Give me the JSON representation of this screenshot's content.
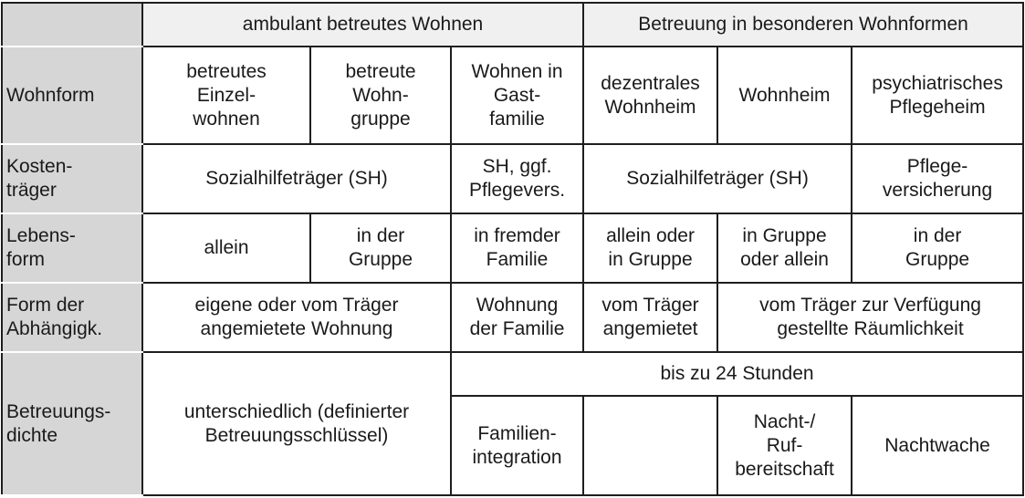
{
  "table": {
    "group_headers": {
      "ambulant": "ambulant betreutes Wohnen",
      "besondere": "Betreuung in besonderen Wohnformen"
    },
    "row_labels": {
      "wohnform": "Wohnform",
      "kostentraeger": "Kosten-\nträger",
      "lebensform": "Lebens-\nform",
      "abhaengigkeit": "Form der\nAbhängigk.",
      "betreuungsdichte": "Betreuungs-\ndichte"
    },
    "wohnform": {
      "c1": "betreutes\nEinzel-\nwohnen",
      "c2": "betreute\nWohn-\ngruppe",
      "c3": "Wohnen in\nGast-\nfamilie",
      "c4": "dezentrales\nWohnheim",
      "c5": "Wohnheim",
      "c6": "psychiatrisches\nPflegeheim"
    },
    "kostentraeger": {
      "c1_2": "Sozialhilfeträger (SH)",
      "c3": "SH, ggf.\nPflegevers.",
      "c4_5": "Sozialhilfeträger (SH)",
      "c6": "Pflege-\nversicherung"
    },
    "lebensform": {
      "c1": "allein",
      "c2": "in der\nGruppe",
      "c3": "in fremder\nFamilie",
      "c4": "allein oder\nin Gruppe",
      "c5": "in Gruppe\noder allein",
      "c6": "in der\nGruppe"
    },
    "abhaengigkeit": {
      "c1_2": "eigene oder vom Träger\nangemietete Wohnung",
      "c3": "Wohnung\nder Familie",
      "c4": "vom Träger\nangemietet",
      "c5_6": "vom Träger zur Verfügung\ngestellte Räumlichkeit"
    },
    "betreuungsdichte": {
      "c1_2": "unterschiedlich (definierter\nBetreuungsschlüssel)",
      "c3_6": "bis zu 24 Stunden",
      "c3": "Familien-\nintegration",
      "c4": "",
      "c5": "Nacht-/\nRuf-\nbereitschaft",
      "c6": "Nachtwache"
    }
  }
}
